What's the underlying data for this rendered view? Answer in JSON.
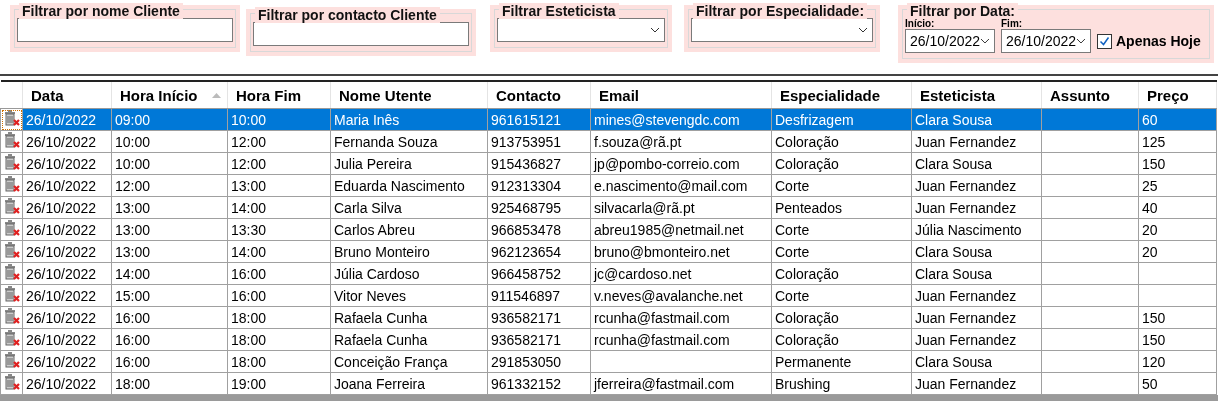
{
  "filters": [
    {
      "kind": "text",
      "label": "Filtrar por nome Cliente"
    },
    {
      "kind": "text",
      "label": "Filtrar por contacto Cliente"
    },
    {
      "kind": "select",
      "label": "Filtrar Esteticista"
    },
    {
      "kind": "select",
      "label": "Filtrar por Especialidade:"
    },
    {
      "kind": "date",
      "label": "Filtrar por Data:",
      "start_label": "Início:",
      "start": "26/10/2022",
      "end_label": "Fim:",
      "end": "26/10/2022",
      "today_label": "Apenas Hoje",
      "today_checked": true
    }
  ],
  "table": {
    "columns": [
      {
        "label": "Data",
        "sorted": false
      },
      {
        "label": "Hora Início",
        "sorted": true
      },
      {
        "label": "Hora Fim",
        "sorted": false
      },
      {
        "label": "Nome Utente",
        "sorted": false
      },
      {
        "label": "Contacto",
        "sorted": false
      },
      {
        "label": "Email",
        "sorted": false
      },
      {
        "label": "Especialidade",
        "sorted": false
      },
      {
        "label": "Esteticista",
        "sorted": false
      },
      {
        "label": "Assunto",
        "sorted": false
      },
      {
        "label": "Preço",
        "sorted": false
      }
    ],
    "rows": [
      {
        "selected": true,
        "cells": [
          "26/10/2022",
          "09:00",
          "10:00",
          "Maria Inês",
          "961615121",
          "mines@stevengdc.com",
          "Desfrizagem",
          "Clara Sousa",
          "",
          "60"
        ]
      },
      {
        "selected": false,
        "cells": [
          "26/10/2022",
          "10:00",
          "12:00",
          "Fernanda Souza",
          "913753951",
          "f.souza@rã.pt",
          "Coloração",
          "Juan Fernandez",
          "",
          "125"
        ]
      },
      {
        "selected": false,
        "cells": [
          "26/10/2022",
          "10:00",
          "12:00",
          "Julia Pereira",
          "915436827",
          "jp@pombo-correio.com",
          "Coloração",
          "Clara Sousa",
          "",
          "150"
        ]
      },
      {
        "selected": false,
        "cells": [
          "26/10/2022",
          "12:00",
          "13:00",
          "Eduarda Nascimento",
          "912313304",
          "e.nascimento@mail.com",
          "Corte",
          "Juan Fernandez",
          "",
          "25"
        ]
      },
      {
        "selected": false,
        "cells": [
          "26/10/2022",
          "13:00",
          "14:00",
          "Carla Silva",
          "925468795",
          "silvacarla@rã.pt",
          "Penteados",
          "Juan Fernandez",
          "",
          "40"
        ]
      },
      {
        "selected": false,
        "cells": [
          "26/10/2022",
          "13:00",
          "13:30",
          "Carlos Abreu",
          "966853478",
          "abreu1985@netmail.net",
          "Corte",
          "Júlia Nascimento",
          "",
          "20"
        ]
      },
      {
        "selected": false,
        "cells": [
          "26/10/2022",
          "13:00",
          "14:00",
          "Bruno Monteiro",
          "962123654",
          "bruno@bmonteiro.net",
          "Corte",
          "Clara Sousa",
          "",
          "20"
        ]
      },
      {
        "selected": false,
        "cells": [
          "26/10/2022",
          "14:00",
          "16:00",
          "Júlia Cardoso",
          "966458752",
          "jc@cardoso.net",
          "Coloração",
          "Clara Sousa",
          "",
          ""
        ]
      },
      {
        "selected": false,
        "cells": [
          "26/10/2022",
          "15:00",
          "16:00",
          "Vitor Neves",
          "911546897",
          "v.neves@avalanche.net",
          "Corte",
          "Juan Fernandez",
          "",
          ""
        ]
      },
      {
        "selected": false,
        "cells": [
          "26/10/2022",
          "16:00",
          "18:00",
          "Rafaela Cunha",
          "936582171",
          "rcunha@fastmail.com",
          "Coloração",
          "Juan Fernandez",
          "",
          "150"
        ]
      },
      {
        "selected": false,
        "cells": [
          "26/10/2022",
          "16:00",
          "18:00",
          "Rafaela Cunha",
          "936582171",
          "rcunha@fastmail.com",
          "Coloração",
          "Juan Fernandez",
          "",
          "150"
        ]
      },
      {
        "selected": false,
        "cells": [
          "26/10/2022",
          "16:00",
          "18:00",
          "Conceição França",
          "291853050",
          "",
          "Permanente",
          "Clara Sousa",
          "",
          "120"
        ]
      },
      {
        "selected": false,
        "cells": [
          "26/10/2022",
          "18:00",
          "19:00",
          "Joana Ferreira",
          "961332152",
          "jferreira@fastmail.com",
          "Brushing",
          "Juan Fernandez",
          "",
          "50"
        ]
      }
    ]
  }
}
